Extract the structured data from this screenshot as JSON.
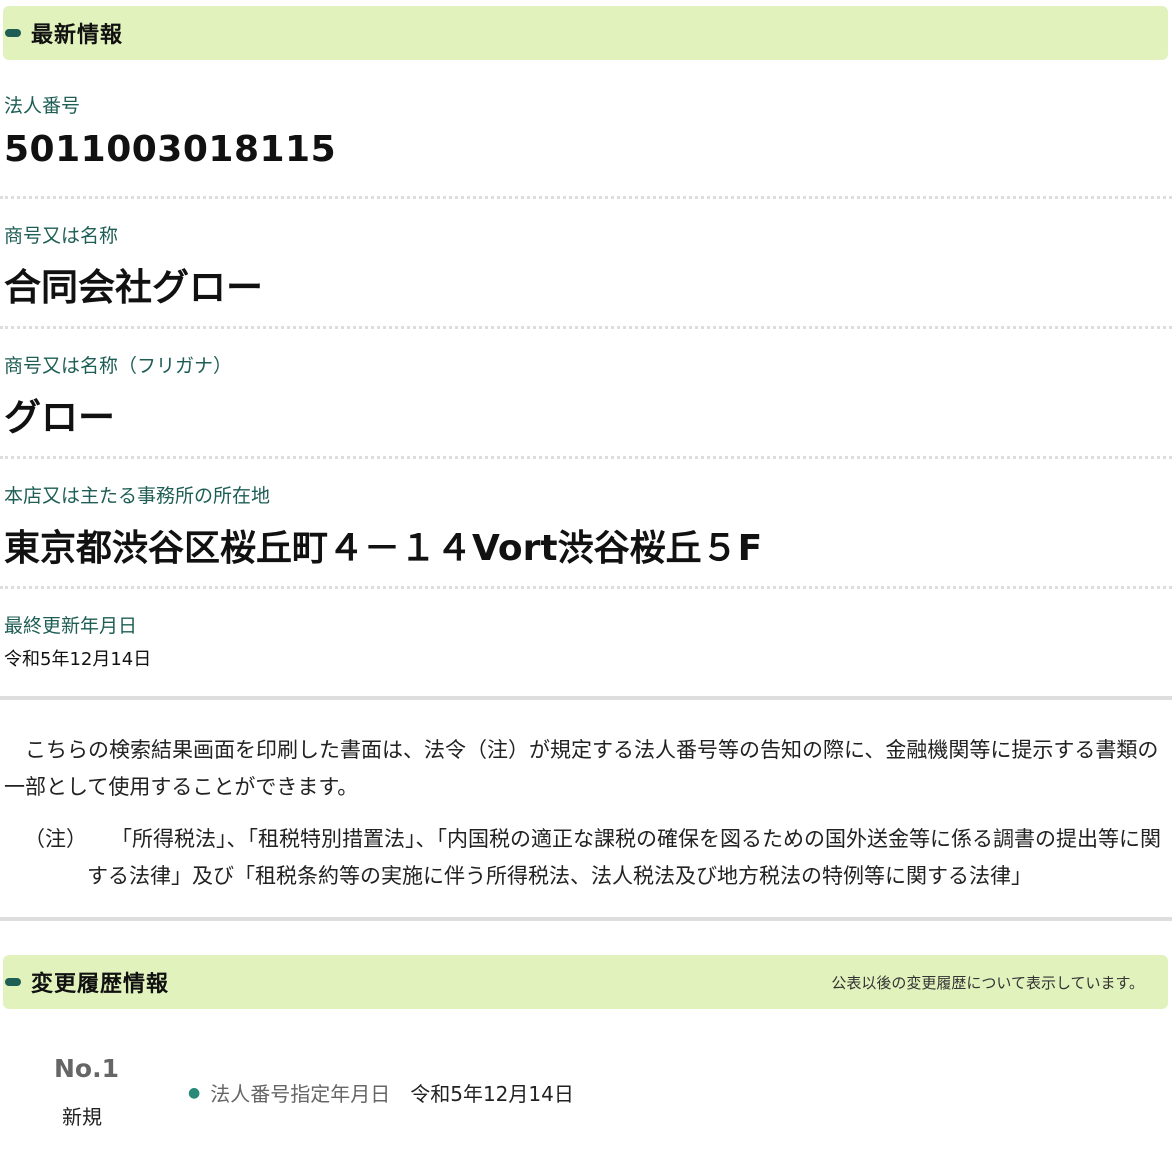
{
  "latest": {
    "header": "最新情報",
    "corp_number_label": "法人番号",
    "corp_number": "5011003018115",
    "name_label": "商号又は名称",
    "name": "合同会社グロー",
    "furigana_label": "商号又は名称（フリガナ）",
    "furigana": "グロー",
    "address_label": "本店又は主たる事務所の所在地",
    "address": "東京都渋谷区桜丘町４－１４Vort渋谷桜丘５F",
    "updated_label": "最終更新年月日",
    "updated": "令和5年12月14日"
  },
  "notice": {
    "text": "こちらの検索結果画面を印刷した書面は、法令（注）が規定する法人番号等の告知の際に、金融機関等に提示する書類の一部として使用することができます。",
    "note_marker": "（注）",
    "note_text": "「所得税法」、「租税特別措置法」、「内国税の適正な課税の確保を図るための国外送金等に係る調書の提出等に関する法律」及び「租税条約等の実施に伴う所得税法、法人税法及び地方税法の特例等に関する法律」"
  },
  "history": {
    "header": "変更履歴情報",
    "note": "公表以後の変更履歴について表示しています。",
    "entries": [
      {
        "no": "No.1",
        "type": "新規",
        "label": "法人番号指定年月日",
        "value": "令和5年12月14日"
      }
    ]
  },
  "colors": {
    "header_bg": "#e1f2bd",
    "label": "#1e5e55",
    "marker": "#1e5e55"
  }
}
